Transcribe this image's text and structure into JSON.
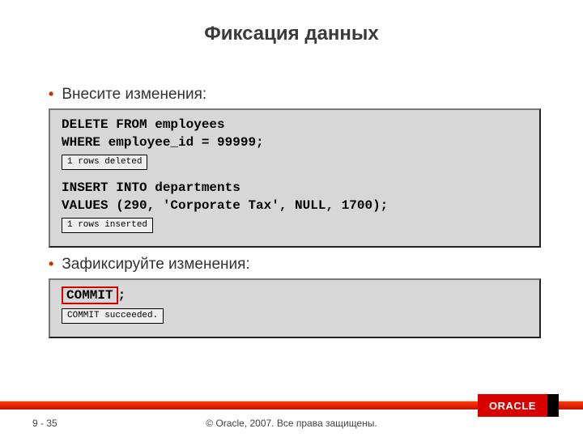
{
  "title": "Фиксация данных",
  "bullets": {
    "make_changes": "Внесите изменения:",
    "commit_changes": "Зафиксируйте изменения:"
  },
  "codebox1": {
    "line1": "DELETE FROM employees",
    "line2": "WHERE  employee_id = 99999;",
    "result1": "1 rows deleted",
    "line3": "INSERT INTO departments",
    "line4": "VALUES (290, 'Corporate Tax', NULL, 1700);",
    "result2": "1 rows inserted"
  },
  "codebox2": {
    "highlight": "COMMIT",
    "semicolon": ";",
    "result": "COMMIT succeeded."
  },
  "footer": {
    "page": "9 - 35",
    "copyright": "© Oracle, 2007. Все права защищены.",
    "logo": "ORACLE"
  }
}
